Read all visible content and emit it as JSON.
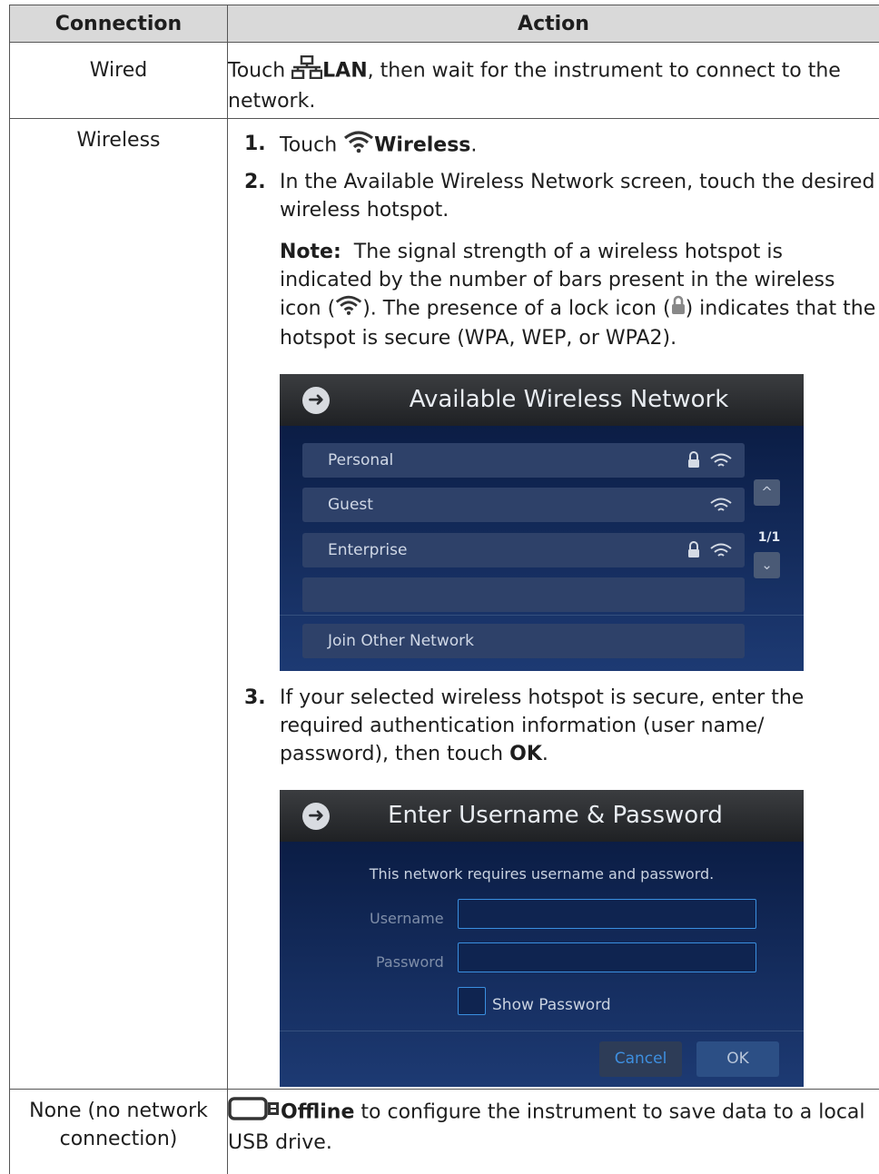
{
  "table": {
    "header": {
      "connection": "Connection",
      "action": "Action"
    },
    "rows": {
      "wired": {
        "connection": "Wired",
        "action_prefix": "Touch",
        "action_bold": "LAN",
        "action_suffix": ", then wait for the instrument to connect to the network."
      },
      "wireless": {
        "connection": "Wireless",
        "step1_num": "1.",
        "step1_prefix": "Touch",
        "step1_bold": "Wireless",
        "step1_suffix": ".",
        "step2_num": "2.",
        "step2_text": "In the Available Wireless Network screen, touch the desired wireless hotspot.",
        "note_label": "Note:",
        "note_text1": "The signal strength of a wireless hotspot is indicated by the number of bars present in the wireless icon (",
        "note_text2": "). The presence of a lock icon (",
        "note_text3": ") indicates that the hotspot is secure (WPA, WEP, or WPA2).",
        "step3_num": "3.",
        "step3_text": "If your selected wireless hotspot is secure, enter the required authentication information (user name/ password), then touch",
        "step3_bold": "OK",
        "step3_suffix": "."
      },
      "none": {
        "connection": "None (no network connection)",
        "action_bold": "Offline",
        "action_suffix": "to configure the instrument to save data to a local USB drive."
      }
    }
  },
  "wireless_screen": {
    "title": "Available Wireless Network",
    "networks": [
      {
        "name": "Personal",
        "icons": [
          "lock-icon",
          "wifi-icon"
        ]
      },
      {
        "name": "Guest",
        "icons": [
          "wifi-icon"
        ]
      },
      {
        "name": "Enterprise",
        "icons": [
          "lock-icon",
          "wifi-icon"
        ]
      },
      {
        "name": "",
        "icons": []
      }
    ],
    "page": "1/1",
    "join_other": "Join Other Network"
  },
  "login_screen": {
    "title": "Enter Username & Password",
    "message": "This network requires username and password.",
    "username_label": "Username",
    "password_label": "Password",
    "show_password": "Show Password",
    "cancel": "Cancel",
    "ok": "OK"
  },
  "colors": {
    "header_bg": "#d9d9d9",
    "screen_bg": "#13295a",
    "field_border": "#3a8fe0"
  }
}
